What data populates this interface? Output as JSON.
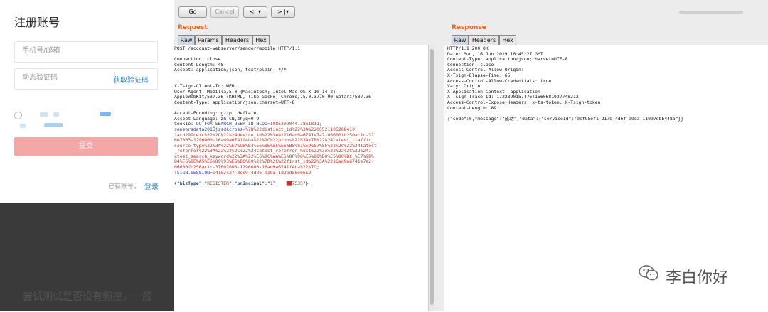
{
  "signup": {
    "title": "注册账号",
    "phone_placeholder": "手机号/邮箱",
    "code_placeholder": "动态验证码",
    "get_code": "获取验证码",
    "submit": "提交",
    "login_hint": "已有账号，",
    "login_link": "登录"
  },
  "caption": "尝试测试是否设有频控，一般",
  "toolbar": {
    "go": "Go",
    "cancel": "Cancel",
    "back": "< |▾",
    "forward": "> |▾"
  },
  "request": {
    "title": "Request",
    "tabs": [
      "Raw",
      "Params",
      "Headers",
      "Hex"
    ],
    "lines": [
      "POST /account-webserver/sender/mobile HTTP/1.1",
      "",
      "Connection: close",
      "Content-Length: 48",
      "Accept: application/json, text/plain, */*",
      "",
      "",
      "X-Tsign-Client-Id: WEB",
      "User-Agent: Mozilla/5.0 (Macintosh; Intel Mac OS X 10_14_2)",
      "AppleWebKit/537.36 (KHTML, like Gecko) Chrome/75.0.3770.90 Safari/537.36",
      "Content-Type: application/json;charset=UTF-8",
      "",
      "Accept-Encoding: gzip, deflate",
      "Accept-Language: zh-CN,zh;q=0.9"
    ],
    "cookie_prefix": "Cookie: ",
    "cookie_name": "OUTFOX_SEARCH_USER_ID_NCOO",
    "cookie_value": "=1085309044.1851811;",
    "sensors_name": "sensorsdata2015jssdkcross",
    "sensors_lines": [
      "=%7B%22distinct_id%22%3A%2200521106288410",
      "1acd299cefc%22%2C%22%24device_id%22%3A%2216ad9a6741e7a2-06600fb250ac1c-37",
      "607003-1296000-16ad9a6741f4ba%22%2C%22props%22%3A%7B%22%24latest_traffic_",
      "source_type%22%3A%22%E7%9B%B4%E6%8E%A5%E6%B5%81%E9%87%8F%22%2C%22%24latest",
      "_referrer%22%3A%22%22%2C%22%24latest_referrer_host%22%3A%22%22%2C%22%241",
      "atest_search_keyword%22%3A%22%E6%9C%AA%E5%8F%96%E5%88%B0%E5%80%BC_%E7%9B%",
      "B4%E6%8E%A5%E6%89%93%E5%BC%80%22%7D%2C%22first_id%22%3A%2216ad9a6741e7a2-",
      "06600fb250ac1c-37607003-1296000-16ad9a6741f4ba%22%7D;"
    ],
    "tsign_name": "TSIGN.SESSION",
    "tsign_value": "=c4152ca7-8ec9-4d26-a19a-1d2ed58e0512",
    "body_open": "{\"",
    "body_k1": "bizType",
    "body_mid1": "\":\"",
    "body_v1": "REGISTER",
    "body_mid2": "\",\"",
    "body_k2": "principal",
    "body_mid3": "\":\"",
    "body_v2": "17    ██7535",
    "body_close": "\"}"
  },
  "response": {
    "title": "Response",
    "tabs": [
      "Raw",
      "Headers",
      "Hex"
    ],
    "lines": [
      "HTTP/1.1 200 OK",
      "Date: Sun, 16 Jun 2019 10:45:27 GMT",
      "Content-Type: application/json;charset=UTF-8",
      "Connection: close",
      "Access-Control-Allow-Origin:",
      "X-Tsign-Elapse-Time: 65",
      "Access-Control-Allow-Credentials: true",
      "Vary: Origin",
      "X-Application-Context: application",
      "X-Tsign-Trace-Id: 1722890157T76T1560681927748212",
      "Access-Control-Expose-Headers: x-ts-token, X-Tsign-token",
      "Content-Length: 89"
    ],
    "body": "{\"code\":0,\"message\":\"成功\",\"data\":{\"serviceId\":\"9cf95ef1-2179-4d6f-a9da-11997dbb448a\"}}"
  },
  "watermark": "李白你好",
  "colors": {
    "accent": "#e2692a",
    "submit": "#f4a7a7",
    "link": "#3b82c4"
  }
}
